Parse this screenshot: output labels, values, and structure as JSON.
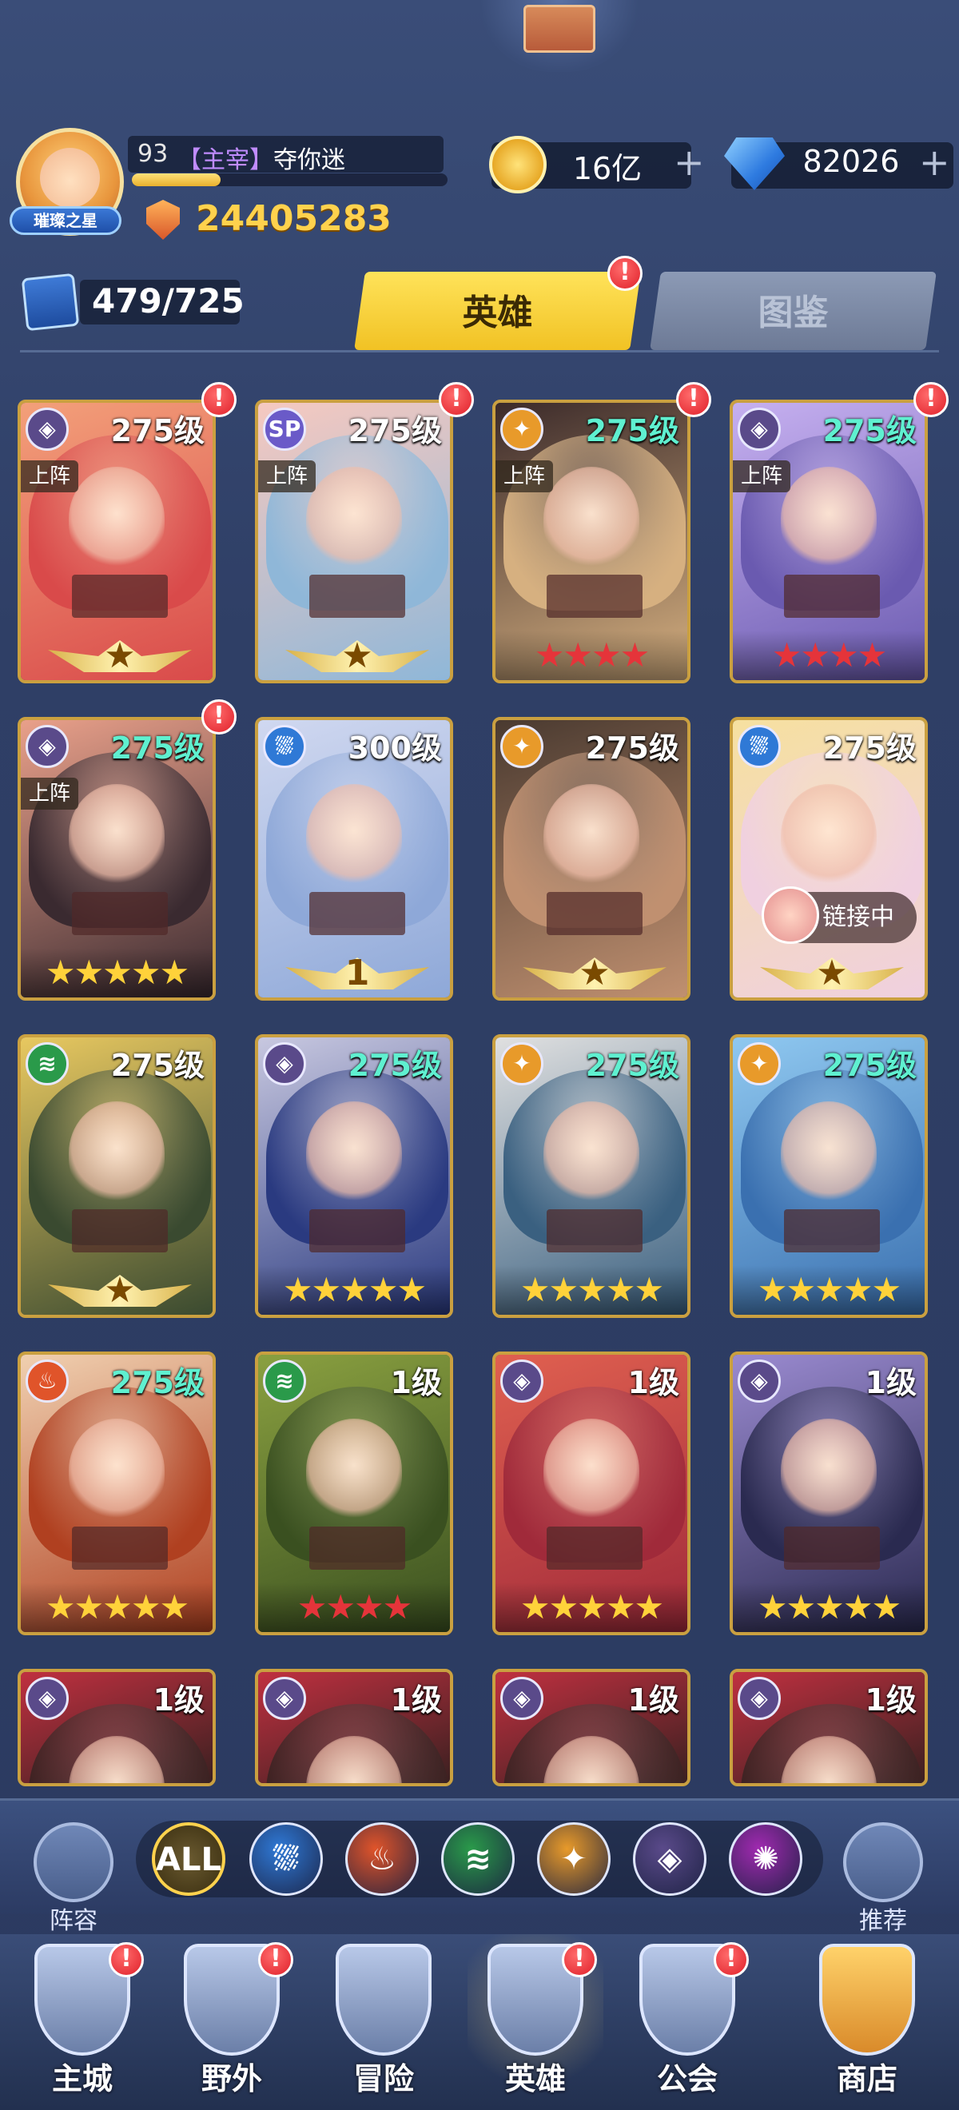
{
  "header": {
    "avatar_badge": "璀璨之星",
    "player_level": "93",
    "player_tag": "【主宰】",
    "player_name": "夺你迷",
    "xp_fraction": 0.28,
    "power": "24405283"
  },
  "currency": {
    "gold": "16亿",
    "gems": "82026",
    "plus": "+"
  },
  "hero_count": "479/725",
  "tabs": [
    {
      "label": "英雄",
      "active": true
    },
    {
      "label": "图鉴",
      "active": false
    }
  ],
  "notif_mark": "!",
  "heroes": [
    {
      "level": "275级",
      "elem": "dark",
      "onboard": "上阵",
      "rank": "wing",
      "badge": true,
      "lvcolor": "w",
      "c1": "#f3a07a",
      "c2": "#d94a4a"
    },
    {
      "level": "275级",
      "elem": "sp",
      "onboard": "上阵",
      "rank": "wing",
      "badge": true,
      "lvcolor": "w",
      "c1": "#f6c9c0",
      "c2": "#8fb7d8"
    },
    {
      "level": "275级",
      "elem": "light",
      "onboard": "上阵",
      "rank": "red4",
      "badge": true,
      "lvcolor": "c",
      "c1": "#3b2a2a",
      "c2": "#d6b080"
    },
    {
      "level": "275级",
      "elem": "dark",
      "onboard": "上阵",
      "rank": "red4",
      "badge": true,
      "lvcolor": "c",
      "c1": "#c6b0f0",
      "c2": "#6a5ab0"
    },
    {
      "level": "275级",
      "elem": "dark",
      "onboard": "上阵",
      "rank": "y5",
      "badge": true,
      "lvcolor": "c",
      "c1": "#e9a08a",
      "c2": "#3a2a30"
    },
    {
      "level": "300级",
      "elem": "water",
      "onboard": "",
      "rank": "wing1",
      "badge": false,
      "lvcolor": "w",
      "c1": "#d0d8f0",
      "c2": "#8ea8d8"
    },
    {
      "level": "275级",
      "elem": "light",
      "onboard": "",
      "rank": "wing",
      "badge": false,
      "lvcolor": "w",
      "c1": "#4a3a30",
      "c2": "#c09070"
    },
    {
      "level": "275级",
      "elem": "water",
      "onboard": "",
      "rank": "wing",
      "badge": false,
      "lvcolor": "w",
      "c1": "#f6e0a0",
      "c2": "#f0d0e0",
      "linking": "链接中"
    },
    {
      "level": "275级",
      "elem": "wind",
      "onboard": "",
      "rank": "wing",
      "badge": false,
      "lvcolor": "w",
      "c1": "#e8c860",
      "c2": "#3a4a30"
    },
    {
      "level": "275级",
      "elem": "dark",
      "onboard": "",
      "rank": "y5",
      "badge": false,
      "lvcolor": "c",
      "c1": "#c8c8e0",
      "c2": "#2a3a80"
    },
    {
      "level": "275级",
      "elem": "light",
      "onboard": "",
      "rank": "y5",
      "badge": false,
      "lvcolor": "c",
      "c1": "#e0e0e0",
      "c2": "#3a6080"
    },
    {
      "level": "275级",
      "elem": "light",
      "onboard": "",
      "rank": "y5",
      "badge": false,
      "lvcolor": "c",
      "c1": "#8fc8f0",
      "c2": "#3a70b0"
    },
    {
      "level": "275级",
      "elem": "fire",
      "onboard": "",
      "rank": "y5",
      "badge": false,
      "lvcolor": "c",
      "c1": "#f0d0b0",
      "c2": "#b04020"
    },
    {
      "level": "1级",
      "elem": "wind",
      "onboard": "",
      "rank": "red4",
      "badge": false,
      "lvcolor": "w",
      "c1": "#8aa040",
      "c2": "#3a5020"
    },
    {
      "level": "1级",
      "elem": "dark",
      "onboard": "",
      "rank": "y5",
      "badge": false,
      "lvcolor": "w",
      "c1": "#e06050",
      "c2": "#a02a3a"
    },
    {
      "level": "1级",
      "elem": "dark",
      "onboard": "",
      "rank": "y5",
      "badge": false,
      "lvcolor": "w",
      "c1": "#9a8ad0",
      "c2": "#2a2a50"
    },
    {
      "level": "1级",
      "elem": "dark",
      "onboard": "",
      "rank": "none",
      "badge": false,
      "lvcolor": "w",
      "c1": "#c03040",
      "c2": "#3a2020"
    },
    {
      "level": "1级",
      "elem": "dark",
      "onboard": "",
      "rank": "none",
      "badge": false,
      "lvcolor": "w",
      "c1": "#c03040",
      "c2": "#3a2020"
    },
    {
      "level": "1级",
      "elem": "dark",
      "onboard": "",
      "rank": "none",
      "badge": false,
      "lvcolor": "w",
      "c1": "#c03040",
      "c2": "#3a2020"
    },
    {
      "level": "1级",
      "elem": "dark",
      "onboard": "",
      "rank": "none",
      "badge": false,
      "lvcolor": "w",
      "c1": "#c03040",
      "c2": "#3a2020"
    }
  ],
  "wing_number": "1",
  "sp_label": "SP",
  "filters": {
    "lineup_label": "阵容",
    "recommend_label": "推荐",
    "all_label": "ALL",
    "elements": [
      "water",
      "fire",
      "wind",
      "light",
      "dark",
      "arcane"
    ]
  },
  "colors": {
    "water": "#2f79d6",
    "fire": "#e0542a",
    "wind": "#2a9a4a",
    "light": "#e89a2a",
    "dark": "#5a4a8a",
    "arcane": "#a02ab0",
    "sp": "#6a5ac8",
    "accent": "#f1c224"
  },
  "nav": [
    {
      "label": "主城",
      "badge": true
    },
    {
      "label": "野外",
      "badge": true
    },
    {
      "label": "冒险",
      "badge": false
    },
    {
      "label": "英雄",
      "badge": true,
      "active": true
    },
    {
      "label": "公会",
      "badge": true
    },
    {
      "label": "商店",
      "badge": false
    }
  ]
}
